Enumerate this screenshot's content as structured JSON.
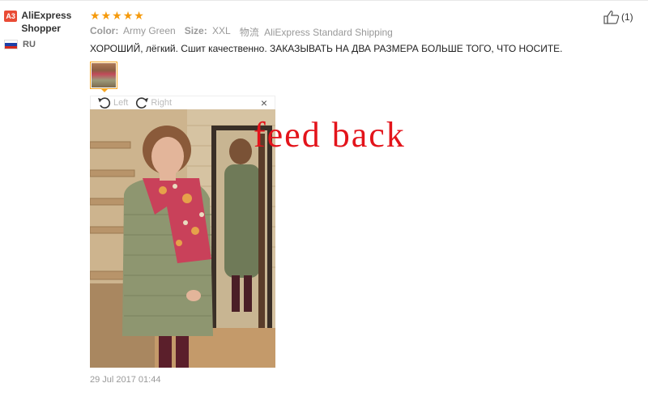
{
  "user": {
    "badge": "A3",
    "name": "AliExpress Shopper",
    "country_code": "RU",
    "flag_colors": [
      "#ffffff",
      "#1c3fa8",
      "#d52b1e"
    ]
  },
  "rating": {
    "stars": 5,
    "max": 5,
    "color": "#f59a0c"
  },
  "attributes": [
    {
      "label": "Color:",
      "value": "Army Green"
    },
    {
      "label": "Size:",
      "value": "XXL"
    },
    {
      "label": "物流",
      "value": "AliExpress Standard Shipping"
    }
  ],
  "review_text": "ХОРОШИЙ, лёгкий. Сшит качественно. ЗАКАЗЫВАТЬ НА ДВА РАЗМЕРА БОЛЬШЕ ТОГО, ЧТО НОСИТЕ.",
  "viewer": {
    "rotate_left": "Left",
    "rotate_right": "Right",
    "close": "×"
  },
  "watermark": "feed back",
  "date": "29 Jul 2017 01:44",
  "helpful": {
    "icon": "thumbs-up-icon",
    "count": "(1)"
  }
}
